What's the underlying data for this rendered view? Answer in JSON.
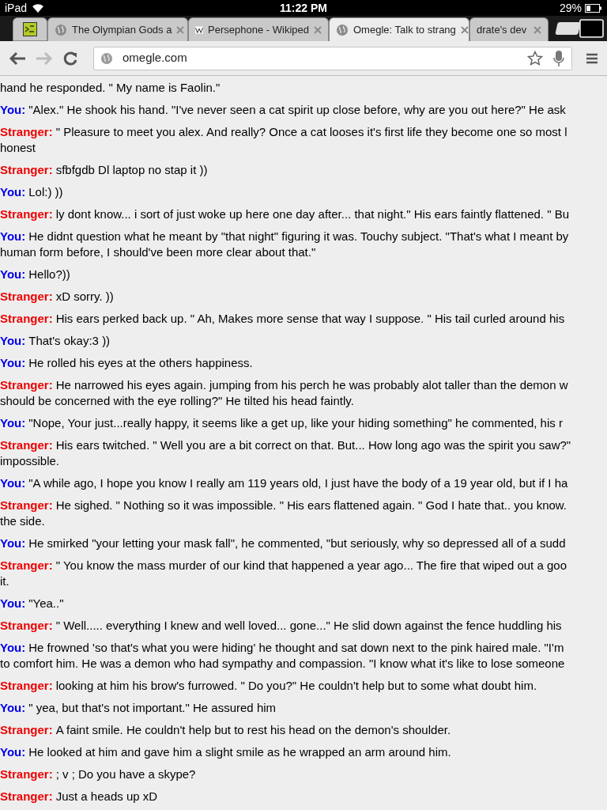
{
  "status_bar": {
    "device": "iPad",
    "time": "11:22 PM",
    "battery": "29%"
  },
  "tabs": [
    {
      "kind": "icon-only",
      "selected": false
    },
    {
      "kind": "globe",
      "title": "The Olympian Gods a",
      "selected": false
    },
    {
      "kind": "wiki",
      "title": "Persephone - Wikiped",
      "selected": false
    },
    {
      "kind": "globe",
      "title": "Omegle: Talk to strang",
      "selected": true
    },
    {
      "kind": "partial",
      "title": "drate's dev",
      "selected": false
    }
  ],
  "toolbar": {
    "url": "omegle.com",
    "forward_disabled": true
  },
  "messages": [
    {
      "lines": [
        "hand he responded. \" My name is Faolin.\""
      ]
    },
    {
      "kind": "you",
      "speaker": "You:",
      "lines": [
        "\"Alex.\" He shook his hand. \"I've never seen a cat spirit up close before, why are you out here?\" He ask"
      ]
    },
    {
      "kind": "stranger",
      "speaker": "Stranger:",
      "lines": [
        "\" Pleasure to meet you alex. And really? Once a cat looses it's first life they become one so most l",
        "honest"
      ]
    },
    {
      "kind": "stranger",
      "speaker": "Stranger:",
      "lines": [
        "sfbfgdb Dl laptop no stap it ))"
      ]
    },
    {
      "kind": "you",
      "speaker": "You:",
      "lines": [
        "Lol:) ))"
      ]
    },
    {
      "kind": "stranger",
      "speaker": "Stranger:",
      "lines": [
        "ly dont know... i sort of just woke up here one day after... that night.\" His ears faintly flattened. \" Bu"
      ]
    },
    {
      "kind": "you",
      "speaker": "You:",
      "lines": [
        "He didnt question what he meant by \"that night\" figuring it was. Touchy subject. \"That's what I meant by",
        "human form before, I should've been more clear about that.\""
      ]
    },
    {
      "kind": "you",
      "speaker": "You:",
      "lines": [
        "Hello?))"
      ]
    },
    {
      "kind": "stranger",
      "speaker": "Stranger:",
      "lines": [
        "xD sorry. ))"
      ]
    },
    {
      "kind": "stranger",
      "speaker": "Stranger:",
      "lines": [
        "His ears perked back up. \" Ah, Makes more sense that way I suppose. \" His tail curled around his"
      ]
    },
    {
      "kind": "you",
      "speaker": "You:",
      "lines": [
        "That's okay:3 ))"
      ]
    },
    {
      "kind": "you",
      "speaker": "You:",
      "lines": [
        "He rolled his eyes at the others happiness."
      ]
    },
    {
      "kind": "stranger",
      "speaker": "Stranger:",
      "lines": [
        "He narrowed his eyes again. jumping from his perch he was probably alot taller than the demon w",
        "should be concerned with the eye rolling?\" He tilted his head faintly."
      ]
    },
    {
      "kind": "you",
      "speaker": "You:",
      "lines": [
        "\"Nope, Your just...really happy, it seems like a get up, like your hiding something\" he commented, his r"
      ]
    },
    {
      "kind": "stranger",
      "speaker": "Stranger:",
      "lines": [
        "His ears twitched. \" Well you are a bit correct on that. But... How long ago was the spirit you saw?\"",
        "impossible."
      ]
    },
    {
      "kind": "you",
      "speaker": "You:",
      "lines": [
        "\"A while ago, I hope you know I really am 119 years old, I just have the body of a 19 year old, but if I ha"
      ]
    },
    {
      "kind": "stranger",
      "speaker": "Stranger:",
      "lines": [
        "He sighed. \" Nothing so it was impossible. \" His ears flattened again. \" God I hate that.. you know.",
        "the side."
      ]
    },
    {
      "kind": "you",
      "speaker": "You:",
      "lines": [
        "He smirked \"your letting your mask fall\", he commented, \"but seriously, why so depressed all of a sudd"
      ]
    },
    {
      "kind": "stranger",
      "speaker": "Stranger:",
      "lines": [
        "\" You know the mass murder of our kind that happened a year ago... The fire that wiped out a goo",
        "it."
      ]
    },
    {
      "kind": "you",
      "speaker": "You:",
      "lines": [
        "\"Yea..\""
      ]
    },
    {
      "kind": "stranger",
      "speaker": "Stranger:",
      "lines": [
        "\" Well..... everything I knew and well loved... gone...\" He slid down against the fence huddling his"
      ]
    },
    {
      "kind": "you",
      "speaker": "You:",
      "lines": [
        "He frowned 'so that's what you were hiding' he thought and sat down next to the pink haired male. \"I'm",
        "to comfort him. He was a demon who had sympathy and compassion. \"I know what it's like to lose someone"
      ]
    },
    {
      "kind": "stranger",
      "speaker": "Stranger:",
      "lines": [
        "looking at him his brow's furrowed. \" Do you?\" He couldn't help but to some what doubt him."
      ]
    },
    {
      "kind": "you",
      "speaker": "You:",
      "lines": [
        "\" yea, but that's not important.\" He assured him"
      ]
    },
    {
      "kind": "stranger",
      "speaker": "Stranger:",
      "lines": [
        "A faint smile. He couldn't help but to rest his head on the demon's shoulder."
      ]
    },
    {
      "kind": "you",
      "speaker": "You:",
      "lines": [
        "He looked at him and gave him a slight smile as he wrapped an arm around him."
      ]
    },
    {
      "kind": "stranger",
      "speaker": "Stranger:",
      "lines": [
        "; v ; Do you have a skype?"
      ]
    },
    {
      "kind": "stranger",
      "speaker": "Stranger:",
      "lines": [
        "Just a heads up xD"
      ]
    }
  ]
}
